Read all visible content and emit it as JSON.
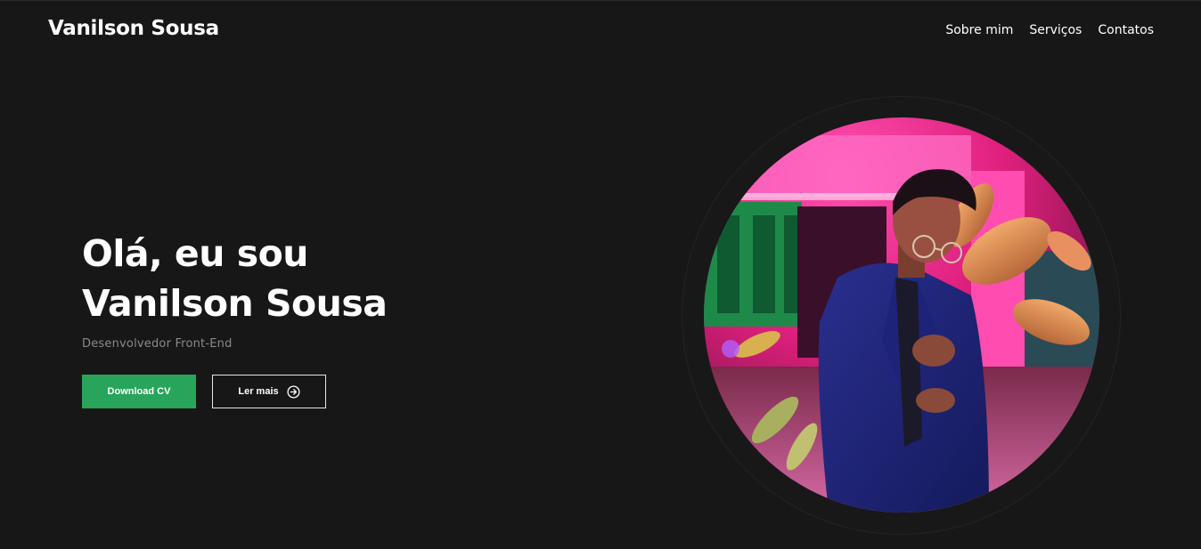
{
  "header": {
    "brand": "Vanilson Sousa",
    "nav": [
      "Sobre mim",
      "Serviços",
      "Contatos"
    ]
  },
  "hero": {
    "title_line1": "Olá, eu sou",
    "title_line2": "Vanilson Sousa",
    "subtitle": "Desenvolvedor Front-End",
    "download_label": "Download CV",
    "more_label": "Ler mais",
    "more_icon": "arrow-right-circle-icon",
    "photo": "profile-photo"
  },
  "colors": {
    "background": "#171717",
    "accent": "#28a55a",
    "text": "#ffffff",
    "muted": "#8a8a8a"
  }
}
